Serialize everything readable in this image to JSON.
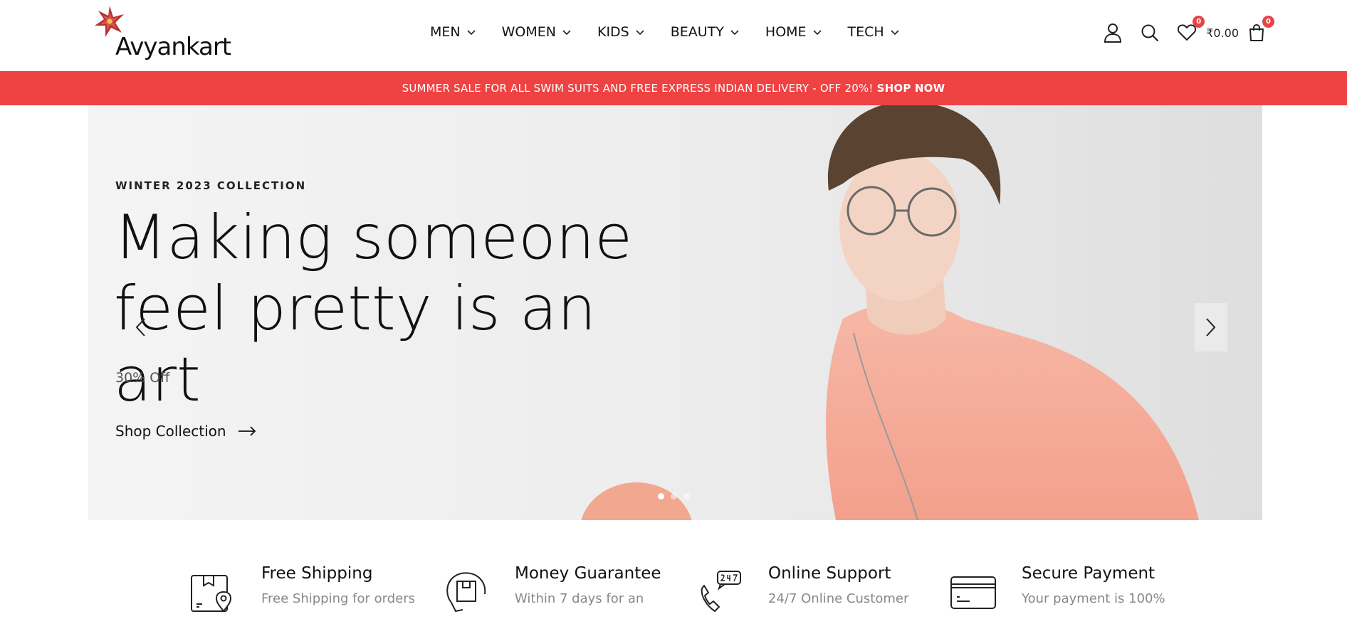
{
  "brand": {
    "name": "Avyankart",
    "logo_icon": "flower-logo-icon"
  },
  "nav": {
    "items": [
      {
        "label": "MEN"
      },
      {
        "label": "WOMEN"
      },
      {
        "label": "KIDS"
      },
      {
        "label": "BEAUTY"
      },
      {
        "label": "HOME"
      },
      {
        "label": "TECH"
      }
    ]
  },
  "header_icons": {
    "account_icon": "user-icon",
    "search_icon": "search-icon",
    "wishlist_icon": "heart-icon",
    "wishlist_count": "0",
    "cart_total": "₹0.00",
    "cart_icon": "shopping-bag-icon",
    "cart_count": "0"
  },
  "announcement": {
    "text": "SUMMER SALE FOR ALL SWIM SUITS AND FREE EXPRESS INDIAN DELIVERY - OFF 20%!",
    "link_label": "SHOP NOW",
    "background": "#ef4242"
  },
  "hero": {
    "kicker": "WINTER 2023 COLLECTION",
    "title": "Making someone feel pretty is an art",
    "offer": "30% Off",
    "cta_label": "Shop Collection",
    "active_slide": 1,
    "slide_count": 3
  },
  "features": [
    {
      "icon": "package-location-icon",
      "title": "Free Shipping",
      "desc": "Free Shipping for orders"
    },
    {
      "icon": "money-back-box-icon",
      "title": "Money Guarantee",
      "desc": "Within 7 days for an"
    },
    {
      "icon": "phone-24-7-icon",
      "title": "Online Support",
      "desc": "24/7 Online Customer"
    },
    {
      "icon": "credit-card-icon",
      "title": "Secure Payment",
      "desc": "Your payment is 100%"
    }
  ],
  "colors": {
    "accent": "#ef4242",
    "text": "#111111",
    "muted": "#888888"
  }
}
